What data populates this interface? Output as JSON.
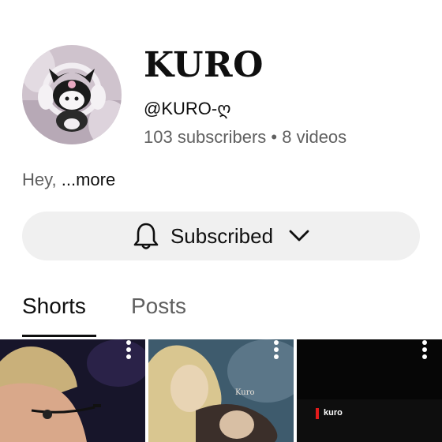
{
  "topbar": {
    "icons": [
      "cast-icon",
      "search-icon"
    ]
  },
  "channel": {
    "name": "KURO",
    "handle": "@KURO-ღ",
    "stats": "103 subscribers • 8 videos",
    "description": "Hey,",
    "more_label": "...more",
    "avatar_icon": "kuromi-avatar"
  },
  "subscribe": {
    "label": "Subscribed",
    "icons": [
      "bell-icon",
      "chevron-down-icon"
    ]
  },
  "tabs": [
    {
      "label": "Shorts",
      "selected": true
    },
    {
      "label": "Posts",
      "selected": false
    }
  ],
  "shorts": [
    {
      "overlay": "",
      "icon": "more-vert-icon"
    },
    {
      "overlay": "Kuro",
      "icon": "more-vert-icon"
    },
    {
      "overlay": "kuro",
      "icon": "more-vert-icon"
    }
  ],
  "colors": {
    "text_primary": "#0f0f0f",
    "text_secondary": "#606060",
    "button_bg": "#f0f0f0",
    "accent_red": "#e21b1b"
  }
}
